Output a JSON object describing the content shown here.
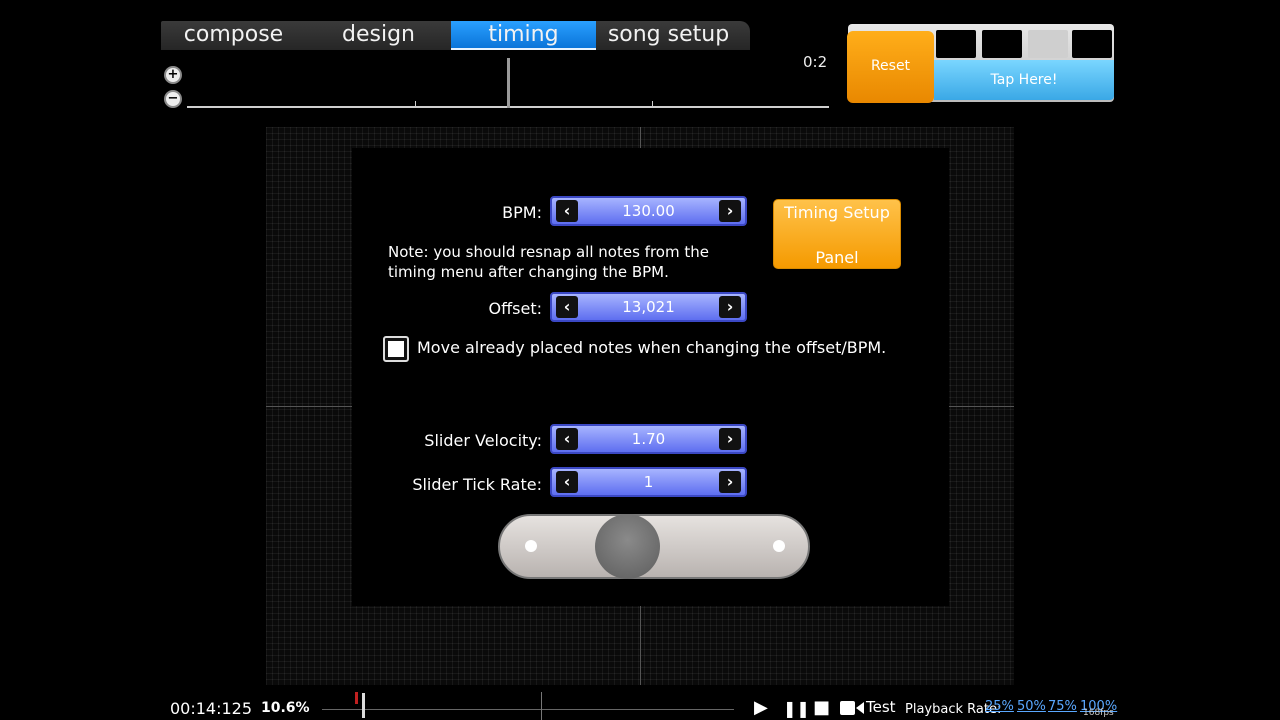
{
  "tabs": [
    {
      "label": "compose"
    },
    {
      "label": "design"
    },
    {
      "label": "timing"
    },
    {
      "label": "song setup"
    }
  ],
  "active_tab": "timing",
  "zoom": {
    "in_glyph": "+",
    "out_glyph": "−"
  },
  "top_time": "0:2",
  "tap": {
    "reset_label": "Reset",
    "tap_label": "Tap Here!"
  },
  "timing": {
    "bpm_label": "BPM:",
    "bpm_value": "130.00",
    "note": "Note: you should resnap all notes from the timing menu after changing the BPM.",
    "offset_label": "Offset:",
    "offset_value": "13,021",
    "move_notes_label": "Move already placed notes when changing the offset/BPM.",
    "move_notes_checked": true,
    "sv_label": "Slider Velocity:",
    "sv_value": "1.70",
    "tick_label": "Slider Tick Rate:",
    "tick_value": "1",
    "setup_button_line1": "Timing Setup",
    "setup_button_line2": "Panel"
  },
  "bottom": {
    "time": "00:14:125",
    "percent": "10.6%",
    "test_label": "Test",
    "playback_label": "Playback Rate:",
    "rates": [
      "25%",
      "50%",
      "75%",
      "100%"
    ],
    "fps": "168fps"
  },
  "icons": {
    "prev": "‹",
    "next": "›",
    "play": "▶",
    "pause": "❚❚",
    "stop": "■"
  },
  "colors": {
    "active_tab": "#1a8cf0",
    "reset": "#f59a00",
    "tap": "#5ab8ef",
    "spinner": "#7c88f4",
    "setup_button": "#f7a70f"
  }
}
